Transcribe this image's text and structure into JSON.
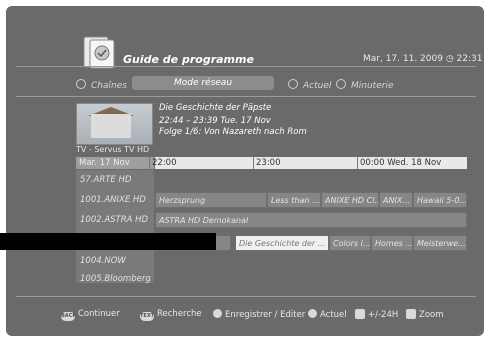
{
  "header": {
    "title": "Guide de programme",
    "datetime": "Mar, 17. 11. 2009   ◷ 22:31"
  },
  "tabs": [
    {
      "label": "Chaînes"
    },
    {
      "label": "Mode réseau"
    },
    {
      "label": "Actuel"
    },
    {
      "label": "Minuterie"
    }
  ],
  "info": {
    "title": "Die Geschichte der Päpste",
    "time": "22:44 – 23:39  Tue. 17 Nov",
    "episode": "Folge 1/6: Von Nazareth nach Rom",
    "channel": "TV - Servus TV HD"
  },
  "timeline": {
    "date": "Mar. 17 Nov",
    "t1": "22:00",
    "t2": "23:00",
    "t3": "00:00 Wed. 18 Nov"
  },
  "channels": [
    "57.ARTE HD",
    "1001.ANIXE HD",
    "1002.ASTRA HD",
    "1004.NOW",
    "1005.Bloomberg"
  ],
  "grid": {
    "row1": [
      "Herzsprung",
      "Less than ...",
      "ANIXE HD Cl...",
      "ANIX...",
      "Hawaii 5-0..."
    ],
    "row2": [
      "ASTRA HD Demokanal"
    ],
    "row3": [
      "Die Geschichte der ...",
      "Colors i...",
      "Homes ...",
      "Meisterwe..."
    ]
  },
  "footer": {
    "continue_key": "BACK",
    "continue": "Continuer",
    "search_key": "TEXT",
    "search": "Recherche",
    "record": "Enregistrer / Editer",
    "actuel": "Actuel",
    "shift": "+/-24H",
    "zoom": "Zoom"
  }
}
